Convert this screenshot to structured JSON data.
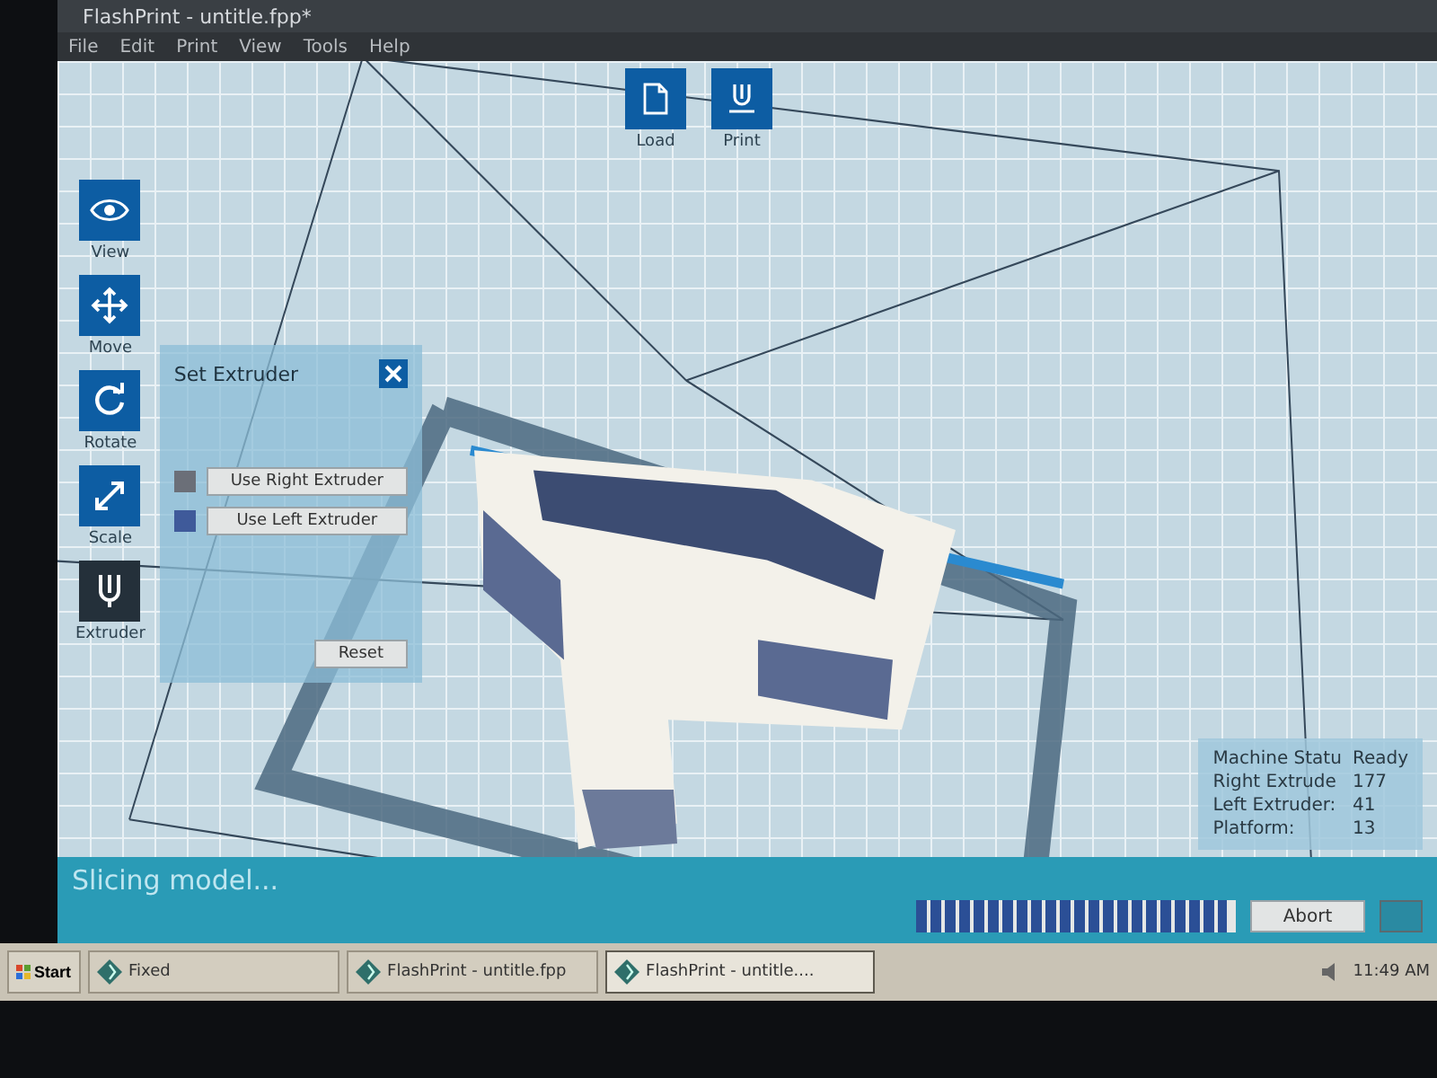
{
  "window": {
    "title": "FlashPrint - untitle.fpp*"
  },
  "menu": [
    "File",
    "Edit",
    "Print",
    "View",
    "Tools",
    "Help"
  ],
  "top_tools": [
    {
      "label": "Load",
      "kind": "load"
    },
    {
      "label": "Print",
      "kind": "print"
    }
  ],
  "side_tools": [
    {
      "label": "View",
      "kind": "view",
      "selected": false
    },
    {
      "label": "Move",
      "kind": "move",
      "selected": false
    },
    {
      "label": "Rotate",
      "kind": "rotate",
      "selected": false
    },
    {
      "label": "Scale",
      "kind": "scale",
      "selected": false
    },
    {
      "label": "Extruder",
      "kind": "extruder",
      "selected": true
    }
  ],
  "extruder_panel": {
    "title": "Set Extruder",
    "options": [
      {
        "label": "Use Right Extruder",
        "color": "#6b6f78"
      },
      {
        "label": "Use Left Extruder",
        "color": "#3f5a9a"
      }
    ],
    "reset": "Reset"
  },
  "machine_status": [
    {
      "label": "Machine Statu",
      "value": "Ready"
    },
    {
      "label": "Right Extrude",
      "value": "177"
    },
    {
      "label": "Left Extruder:",
      "value": "41"
    },
    {
      "label": "Platform:",
      "value": "13"
    }
  ],
  "status_bar": {
    "message": "Slicing model...",
    "progress": {
      "level": 0.97
    },
    "abort": "Abort"
  },
  "taskbar": {
    "start": "Start",
    "tasks": [
      {
        "label": "Fixed",
        "selected": false
      },
      {
        "label": "FlashPrint - untitle.fpp",
        "selected": false
      },
      {
        "label": "FlashPrint - untitle....",
        "selected": true
      }
    ],
    "clock": "11:49 AM"
  }
}
